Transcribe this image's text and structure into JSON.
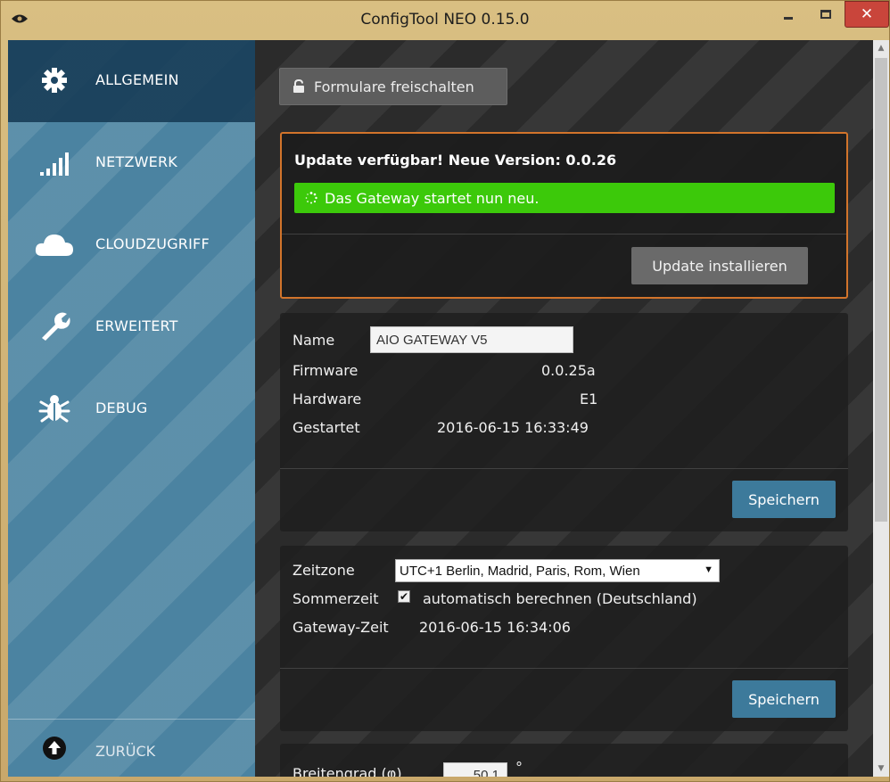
{
  "window": {
    "title": "ConfigTool NEO 0.15.0",
    "close_glyph": "✕"
  },
  "sidebar": {
    "items": [
      {
        "label": "ALLGEMEIN",
        "icon": "gear-icon",
        "active": true
      },
      {
        "label": "NETZWERK",
        "icon": "signal-bars-icon",
        "active": false
      },
      {
        "label": "CLOUDZUGRIFF",
        "icon": "cloud-icon",
        "active": false
      },
      {
        "label": "ERWEITERT",
        "icon": "wrench-icon",
        "active": false
      },
      {
        "label": "DEBUG",
        "icon": "bug-icon",
        "active": false
      }
    ],
    "back": {
      "label": "ZURÜCK",
      "icon": "arrow-up-circle-icon"
    }
  },
  "main": {
    "unlock_button": "Formulare freischalten",
    "update": {
      "title": "Update verfügbar! Neue Version: 0.0.26",
      "status": "Das Gateway startet nun neu.",
      "install_button": "Update installieren"
    },
    "info": {
      "name_label": "Name",
      "name_value": "AIO GATEWAY V5",
      "firmware_label": "Firmware",
      "firmware_value": "0.0.25a",
      "hardware_label": "Hardware",
      "hardware_value": "E1",
      "started_label": "Gestartet",
      "started_value": "2016-06-15 16:33:49",
      "save_button": "Speichern"
    },
    "time": {
      "timezone_label": "Zeitzone",
      "timezone_value": "UTC+1 Berlin, Madrid, Paris, Rom, Wien",
      "dst_label": "Sommerzeit",
      "dst_checked": true,
      "dst_option": "automatisch berechnen (Deutschland)",
      "gateway_time_label": "Gateway-Zeit",
      "gateway_time_value": "2016-06-15 16:34:06",
      "save_button": "Speichern"
    },
    "geo": {
      "latitude_label": "Breitengrad (φ)",
      "latitude_value": "50.1",
      "latitude_unit": "°"
    }
  },
  "colors": {
    "sidebar": "#4b83a1",
    "sidebar_active": "#163a54",
    "main_bg": "#2b2b2b",
    "update_border": "#d2742b",
    "success": "#3cc90a",
    "save_button": "#3d7a9b",
    "title_bar": "#d9bf82",
    "close_button": "#c9453b"
  }
}
